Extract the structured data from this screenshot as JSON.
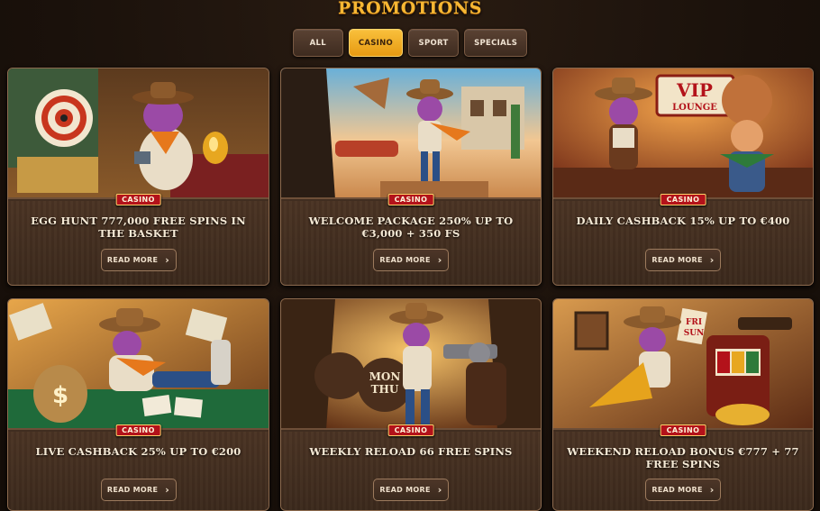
{
  "page": {
    "title": "PROMOTIONS"
  },
  "filters": [
    {
      "label": "ALL",
      "active": false
    },
    {
      "label": "CASINO",
      "active": true
    },
    {
      "label": "SPORT",
      "active": false
    },
    {
      "label": "SPECIALS",
      "active": false
    }
  ],
  "promotions": [
    {
      "badge": "CASINO",
      "title": "EGG HUNT 777,000 FREE SPINS IN THE BASKET",
      "button": "READ MORE",
      "icon": "chevron-right-icon"
    },
    {
      "badge": "CASINO",
      "title": "WELCOME PACKAGE 250% UP TO €3,000 + 350 FS",
      "button": "READ MORE",
      "icon": "chevron-right-icon"
    },
    {
      "badge": "CASINO",
      "title": "DAILY CASHBACK 15% UP TO €400",
      "button": "READ MORE",
      "icon": "chevron-right-icon"
    },
    {
      "badge": "CASINO",
      "title": "LIVE CASHBACK 25% UP TO €200",
      "button": "READ MORE",
      "icon": "chevron-right-icon"
    },
    {
      "badge": "CASINO",
      "title": "WEEKLY RELOAD 66 FREE SPINS",
      "button": "READ MORE",
      "icon": "chevron-right-icon"
    },
    {
      "badge": "CASINO",
      "title": "WEEKEND RELOAD BONUS €777 + 77 FREE SPINS",
      "button": "READ MORE",
      "icon": "chevron-right-icon"
    }
  ],
  "artwork_text": {
    "vip_sign": [
      "VIP",
      "LOUNGE"
    ],
    "bag_symbol": "$",
    "sign_mon_thu": [
      "MON",
      "THU"
    ],
    "sign_fri_sun": [
      "FRI",
      "SUN"
    ]
  },
  "colors": {
    "accent": "#f7b733",
    "active_filter": "#f0a923",
    "badge_red": "#b3121a",
    "card_bg": "#45301f"
  }
}
